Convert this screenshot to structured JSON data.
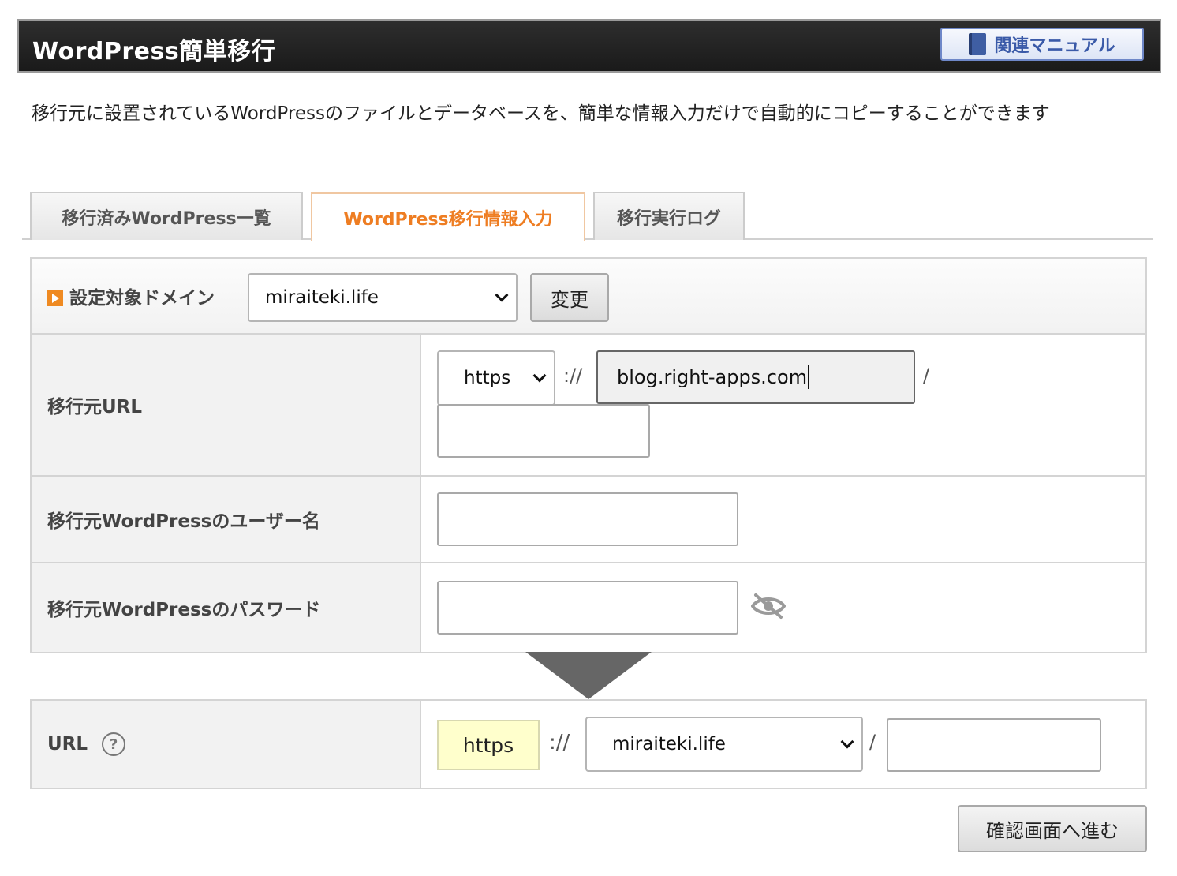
{
  "header": {
    "title": "WordPress簡単移行",
    "manual_label": "関連マニュアル",
    "manual_icon": "book-icon"
  },
  "intro": "移行元に設置されているWordPressのファイルとデータベースを、簡単な情報入力だけで自動的にコピーすることができます",
  "tabs": [
    {
      "label": "移行済みWordPress一覧",
      "active": false
    },
    {
      "label": "WordPress移行情報入力",
      "active": true
    },
    {
      "label": "移行実行ログ",
      "active": false
    }
  ],
  "domain": {
    "label": "設定対象ドメイン",
    "selected": "miraiteki.life",
    "change_label": "変更"
  },
  "source_url": {
    "label": "移行元URL",
    "protocol": "https",
    "separator": "://",
    "host": "blog.right-apps.com",
    "slash": "/",
    "path": ""
  },
  "source_user": {
    "label": "移行元WordPressのユーザー名",
    "value": ""
  },
  "source_password": {
    "label": "移行元WordPressのパスワード",
    "value": "",
    "icon": "eye-slash-icon"
  },
  "target_url": {
    "label": "URL",
    "help": "?",
    "protocol": "https",
    "separator": "://",
    "domain": "miraiteki.life",
    "slash": "/",
    "path": ""
  },
  "confirm_label": "確認画面へ進む",
  "colors": {
    "accent": "#ee7d22",
    "header_bg": "#1a1a1a",
    "link": "#3a5aa8"
  }
}
